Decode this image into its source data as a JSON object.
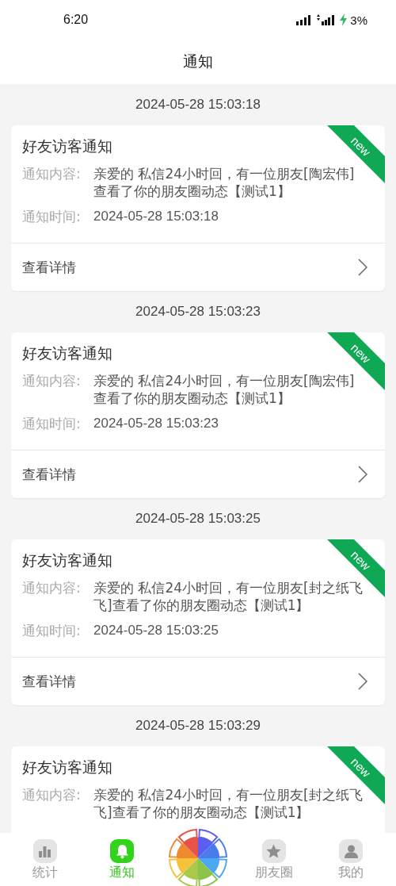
{
  "status_bar": {
    "time": "6:20",
    "battery": "3%"
  },
  "header": {
    "title": "通知"
  },
  "notifications": [
    {
      "timestamp": "2024-05-28 15:03:18",
      "title": "好友访客通知",
      "badge": "new",
      "content_label": "通知内容:",
      "content": "亲爱的 私信24小时回，有一位朋友[陶宏伟]查看了你的朋友圈动态【测试1】",
      "time_label": "通知时间:",
      "time": "2024-05-28 15:03:18",
      "action": "查看详情"
    },
    {
      "timestamp": "2024-05-28 15:03:23",
      "title": "好友访客通知",
      "badge": "new",
      "content_label": "通知内容:",
      "content": "亲爱的 私信24小时回，有一位朋友[陶宏伟]查看了你的朋友圈动态【测试1】",
      "time_label": "通知时间:",
      "time": "2024-05-28 15:03:23",
      "action": "查看详情"
    },
    {
      "timestamp": "2024-05-28 15:03:25",
      "title": "好友访客通知",
      "badge": "new",
      "content_label": "通知内容:",
      "content": "亲爱的 私信24小时回，有一位朋友[封之纸飞飞]查看了你的朋友圈动态【测试1】",
      "time_label": "通知时间:",
      "time": "2024-05-28 15:03:25",
      "action": "查看详情"
    },
    {
      "timestamp": "2024-05-28 15:03:29",
      "title": "好友访客通知",
      "badge": "new",
      "content_label": "通知内容:",
      "content": "亲爱的 私信24小时回，有一位朋友[封之纸飞飞]查看了你的朋友圈动态【测试1】"
    }
  ],
  "tab_bar": {
    "items": [
      {
        "kind": "stats",
        "label": "统计",
        "selected": false
      },
      {
        "kind": "bell",
        "label": "通知",
        "selected": true
      },
      {
        "kind": "wheel"
      },
      {
        "kind": "star",
        "label": "朋友圈",
        "selected": false
      },
      {
        "kind": "person",
        "label": "我的",
        "selected": false
      }
    ]
  }
}
